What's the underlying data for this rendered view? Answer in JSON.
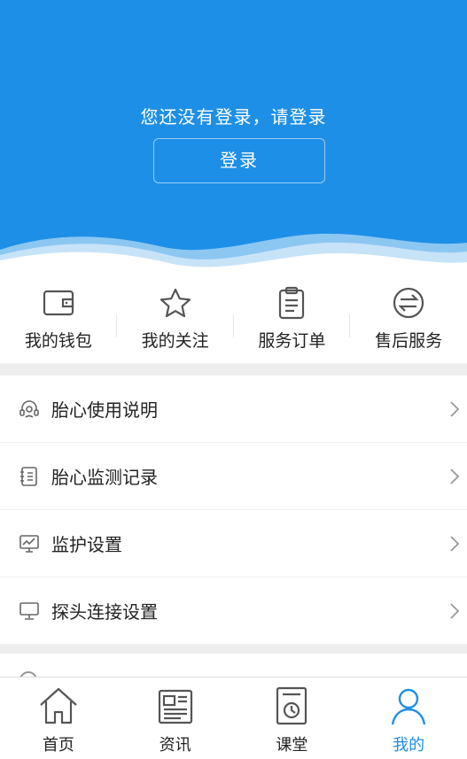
{
  "header": {
    "prompt": "您还没有登录，请登录",
    "login_label": "登录",
    "bg_color": "#1e8fe6"
  },
  "quick_actions": [
    {
      "label": "我的钱包",
      "icon": "wallet-icon"
    },
    {
      "label": "我的关注",
      "icon": "star-icon"
    },
    {
      "label": "服务订单",
      "icon": "clipboard-icon"
    },
    {
      "label": "售后服务",
      "icon": "exchange-icon"
    }
  ],
  "menu": [
    {
      "label": "胎心使用说明",
      "icon": "headset-icon"
    },
    {
      "label": "胎心监测记录",
      "icon": "notebook-icon"
    },
    {
      "label": "监护设置",
      "icon": "monitor-chart-icon"
    },
    {
      "label": "探头连接设置",
      "icon": "desktop-icon"
    }
  ],
  "tabbar": {
    "active_color": "#1e8fe6",
    "tabs": [
      {
        "label": "首页",
        "icon": "home-icon",
        "active": false
      },
      {
        "label": "资讯",
        "icon": "news-icon",
        "active": false
      },
      {
        "label": "课堂",
        "icon": "classroom-icon",
        "active": false
      },
      {
        "label": "我的",
        "icon": "person-icon",
        "active": true
      }
    ]
  }
}
